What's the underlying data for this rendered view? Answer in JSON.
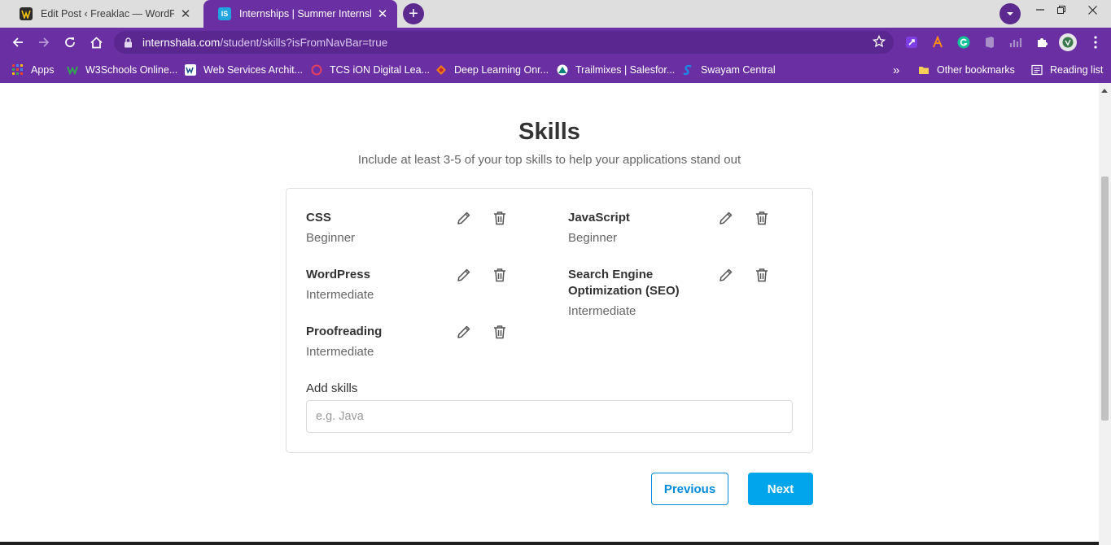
{
  "browser": {
    "tabs": [
      {
        "title": "Edit Post ‹ Freaklac — WordPress",
        "favicon": "wordpress-favicon",
        "active": false
      },
      {
        "title": "Internships | Summer Internship",
        "favicon": "internshala-favicon",
        "active": true
      }
    ],
    "favicon_text": {
      "is": "IS"
    },
    "url_host": "internshala.com",
    "url_path": "/student/skills?isFromNavBar=true",
    "bookmarks": [
      {
        "label": "Apps",
        "icon": "apps-grid-icon"
      },
      {
        "label": "W3Schools Online...",
        "icon": "w3schools-icon"
      },
      {
        "label": "Web Services Archit...",
        "icon": "w3c-icon"
      },
      {
        "label": "TCS iON Digital Lea...",
        "icon": "tcs-ion-icon"
      },
      {
        "label": "Deep Learning Onr...",
        "icon": "deep-learning-icon"
      },
      {
        "label": "Trailmixes | Salesfor...",
        "icon": "trailhead-icon"
      },
      {
        "label": "Swayam Central",
        "icon": "swayam-icon"
      }
    ],
    "bookmarks_overflow": "»",
    "other_bookmarks": "Other bookmarks",
    "reading_list": "Reading list"
  },
  "page": {
    "title": "Skills",
    "subtitle": "Include at least 3-5 of your top skills to help your applications stand out",
    "skills": [
      {
        "name": "CSS",
        "level": "Beginner"
      },
      {
        "name": "JavaScript",
        "level": "Beginner"
      },
      {
        "name": "WordPress",
        "level": "Intermediate"
      },
      {
        "name": "Search Engine Optimization (SEO)",
        "level": "Intermediate"
      },
      {
        "name": "Proofreading",
        "level": "Intermediate"
      }
    ],
    "add_skills_label": "Add skills",
    "add_skills_placeholder": "e.g. Java",
    "previous_label": "Previous",
    "next_label": "Next"
  },
  "colors": {
    "chrome_purple": "#6a2fa3",
    "primary_blue": "#00a5ec",
    "outline_blue": "#008bdc"
  }
}
